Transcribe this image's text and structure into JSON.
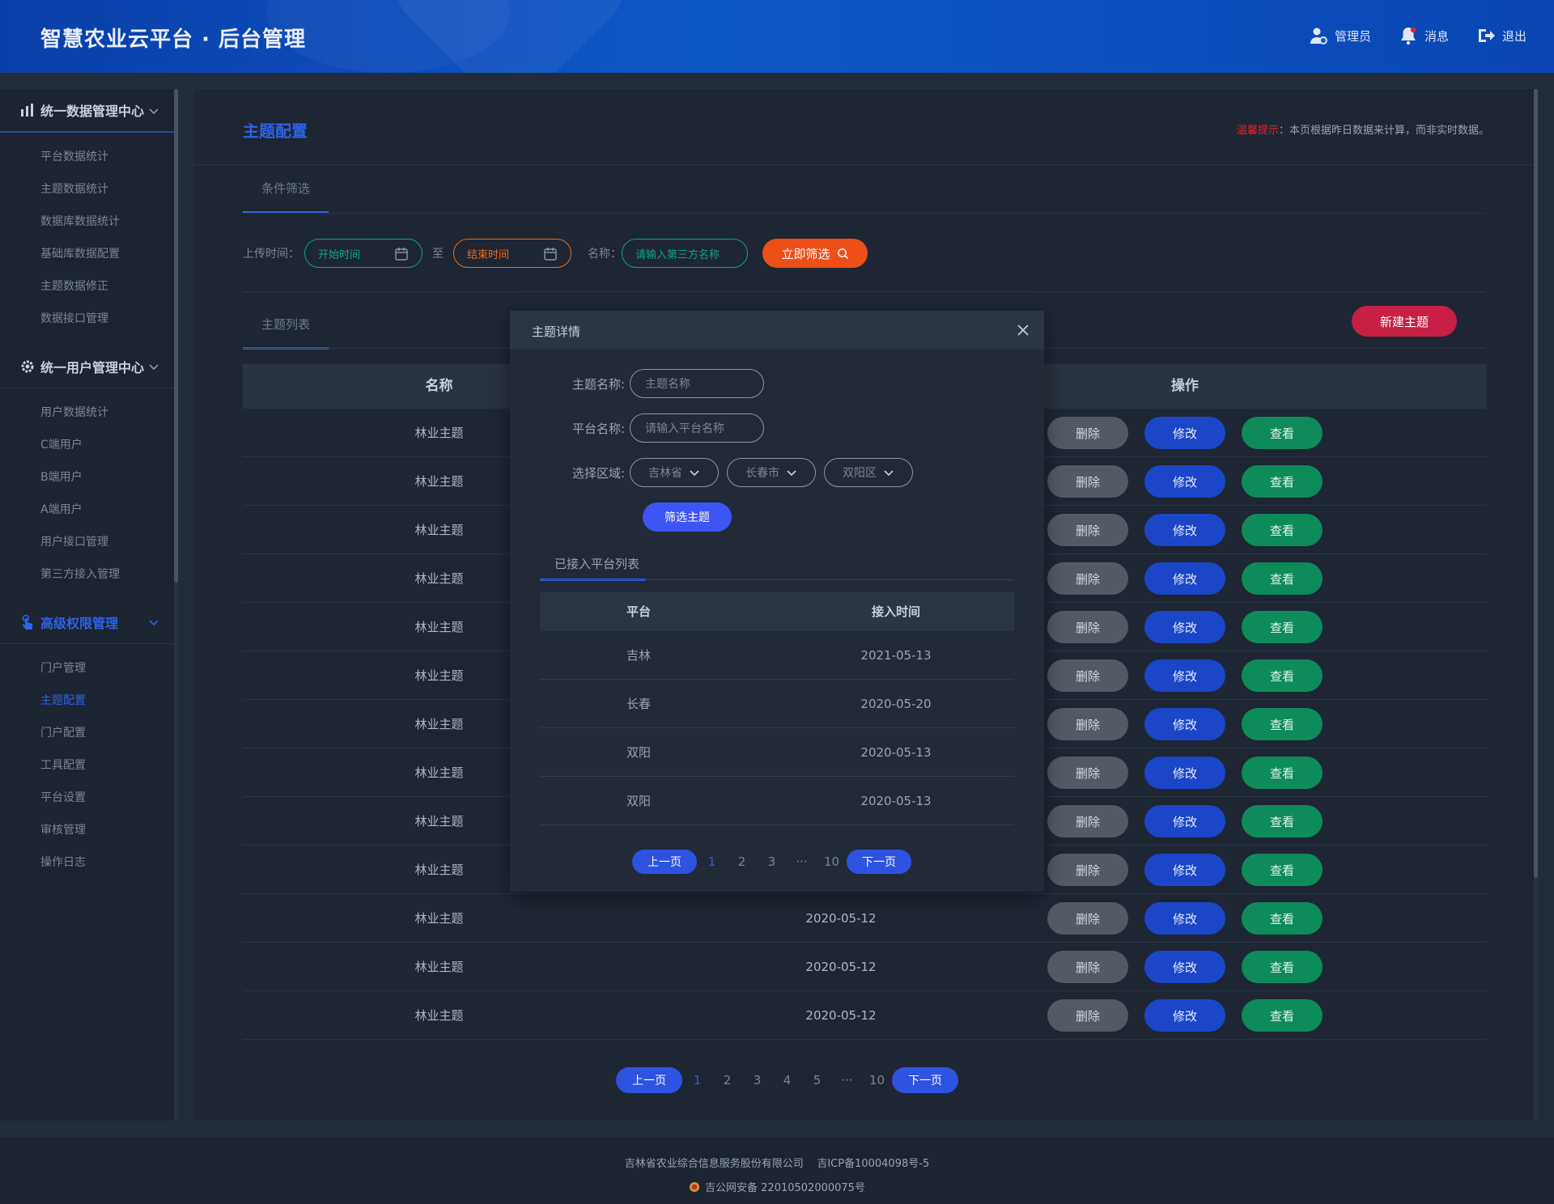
{
  "app": {
    "title": "智慧农业云平台 · 后台管理"
  },
  "header_nav": {
    "admin": "管理员",
    "messages": "消息",
    "logout": "退出"
  },
  "sidebar": {
    "groups": [
      {
        "label": "统一数据管理中心",
        "items": [
          "平台数据统计",
          "主题数据统计",
          "数据库数据统计",
          "基础库数据配置",
          "主题数据修正",
          "数据接口管理"
        ]
      },
      {
        "label": "统一用户管理中心",
        "items": [
          "用户数据统计",
          "C端用户",
          "B端用户",
          "A端用户",
          "用户接口管理",
          "第三方接入管理"
        ]
      },
      {
        "label": "高级权限管理",
        "items": [
          "门户管理",
          "主题配置",
          "门户配置",
          "工具配置",
          "平台设置",
          "审核管理",
          "操作日志"
        ]
      }
    ],
    "active_item": "主题配置"
  },
  "page": {
    "title": "主题配置",
    "notice_label": "温馨提示",
    "notice_text": "：本页根据昨日数据来计算，而非实时数据。",
    "filter_tab": "条件筛选",
    "list_tab": "主题列表",
    "new_button": "新建主题"
  },
  "filter": {
    "upload_time_label": "上传时间：",
    "start_placeholder": "开始时间",
    "to_label": "至",
    "end_placeholder": "结束时间",
    "name_label": "名称：",
    "name_placeholder": "请输入第三方名称",
    "search_button": "立即筛选"
  },
  "table": {
    "headers": {
      "name": "名称",
      "actions": "操作"
    },
    "rows": [
      {
        "name": "林业主题",
        "date": ""
      },
      {
        "name": "林业主题",
        "date": ""
      },
      {
        "name": "林业主题",
        "date": ""
      },
      {
        "name": "林业主题",
        "date": ""
      },
      {
        "name": "林业主题",
        "date": ""
      },
      {
        "name": "林业主题",
        "date": ""
      },
      {
        "name": "林业主题",
        "date": ""
      },
      {
        "name": "林业主题",
        "date": ""
      },
      {
        "name": "林业主题",
        "date": ""
      },
      {
        "name": "林业主题",
        "date": ""
      },
      {
        "name": "林业主题",
        "date": "2020-05-12"
      },
      {
        "name": "林业主题",
        "date": "2020-05-12"
      },
      {
        "name": "林业主题",
        "date": "2020-05-12"
      }
    ],
    "actions": {
      "delete": "删除",
      "edit": "修改",
      "view": "查看"
    }
  },
  "pagination": {
    "prev": "上一页",
    "next": "下一页",
    "pages": [
      "1",
      "2",
      "3",
      "4",
      "5",
      "···",
      "10"
    ],
    "current": "1"
  },
  "modal": {
    "title": "主题详情",
    "theme_name_label": "主题名称:",
    "theme_name_placeholder": "主题名称",
    "platform_name_label": "平台名称:",
    "platform_name_placeholder": "请输入平台名称",
    "region_label": "选择区域:",
    "province": "吉林省",
    "city": "长春市",
    "district": "双阳区",
    "filter_button": "筛选主题",
    "list_tab": "已接入平台列表",
    "headers": {
      "platform": "平台",
      "time": "接入时间"
    },
    "rows": [
      {
        "platform": "吉林",
        "time": "2021-05-13"
      },
      {
        "platform": "长春",
        "time": "2020-05-20"
      },
      {
        "platform": "双阳",
        "time": "2020-05-13"
      },
      {
        "platform": "双阳",
        "time": "2020-05-13"
      }
    ],
    "pagination": {
      "prev": "上一页",
      "next": "下一页",
      "pages": [
        "1",
        "2",
        "3",
        "···",
        "10"
      ],
      "current": "1"
    }
  },
  "footer": {
    "company": "吉林省农业综合信息服务股份有限公司",
    "icp": "吉ICP备10004098号-5",
    "police": "吉公网安备 22010502000075号"
  },
  "colors": {
    "accent": "#2e63e6",
    "danger": "#c81f45",
    "search": "#ec4f17",
    "view": "#0e8b5a",
    "edit": "#1b46c8"
  }
}
